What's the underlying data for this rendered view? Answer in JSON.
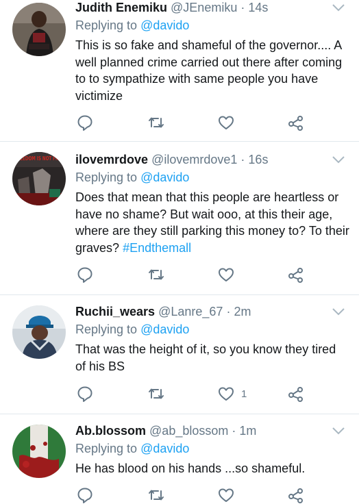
{
  "tweets": [
    {
      "name": "Judith Enemiku",
      "handle": "@JEnemiku",
      "sep": "·",
      "time": "14s",
      "replying_prefix": "Replying to",
      "replying_to": "@davido",
      "body": "This is so fake and shameful of the governor.... A well planned crime carried out there after coming to to sympathize with same people you have victimize",
      "like_count": ""
    },
    {
      "name": "ilovemrdove",
      "handle": "@ilovemrdove1",
      "sep": "·",
      "time": "16s",
      "replying_prefix": "Replying to",
      "replying_to": "@davido",
      "body": "Does that mean that this people are heartless or have no shame? But wait ooo, at this their age, where are they still parking this money to? To their graves?",
      "hashtag": "#Endthemall",
      "avatar_text": "FREEDOM IS NOT FREE",
      "like_count": ""
    },
    {
      "name": "Ruchii_wears",
      "handle": "@Lanre_67",
      "sep": "·",
      "time": "2m",
      "replying_prefix": "Replying to",
      "replying_to": "@davido",
      "body": "That was the height of it, so you know they tired of his BS",
      "like_count": "1"
    },
    {
      "name": "Ab.blossom",
      "handle": "@ab_blossom",
      "sep": "·",
      "time": "1m",
      "replying_prefix": "Replying to",
      "replying_to": "@davido",
      "body": "He has blood on his hands ...so shameful.",
      "like_count": ""
    }
  ],
  "icons": {
    "reply": "reply-icon",
    "retweet": "retweet-icon",
    "like": "like-icon",
    "share": "share-icon",
    "more": "chevron-down-icon"
  },
  "colors": {
    "link": "#1da1f2",
    "muted": "#657786",
    "text": "#14171a",
    "divider": "#e1e8ed"
  }
}
